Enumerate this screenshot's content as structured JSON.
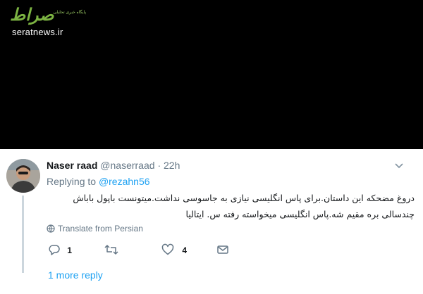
{
  "watermark": {
    "logo_mark": "صراط",
    "tagline": "پایگاه خبری تحلیلی",
    "site": "seratnews.ir",
    "brand_color": "#7cb342"
  },
  "tweet": {
    "author_name": "Naser raad",
    "author_handle": "@naserraad",
    "separator": "·",
    "time": "22h",
    "replying_to_label": "Replying to",
    "replying_to_handle": "@rezahn56",
    "text": "دروغ مضحکه این داستان.برای پاس انگلیسی نیازی به جاسوسی نداشت.میتونست باپول باباش چندسالی بره مقیم شه.پاس انگلیسی میخواسته رفته س. ایتالیا",
    "translate_label": "Translate from Persian",
    "actions": {
      "reply_count": "1",
      "retweet_count": "",
      "like_count": "4"
    },
    "more_replies_label": "1 more reply",
    "icons": [
      "chevron-down-icon",
      "globe-icon",
      "reply-icon",
      "retweet-icon",
      "like-icon",
      "message-icon"
    ],
    "link_color": "#1da1f2",
    "muted_color": "#657786"
  }
}
